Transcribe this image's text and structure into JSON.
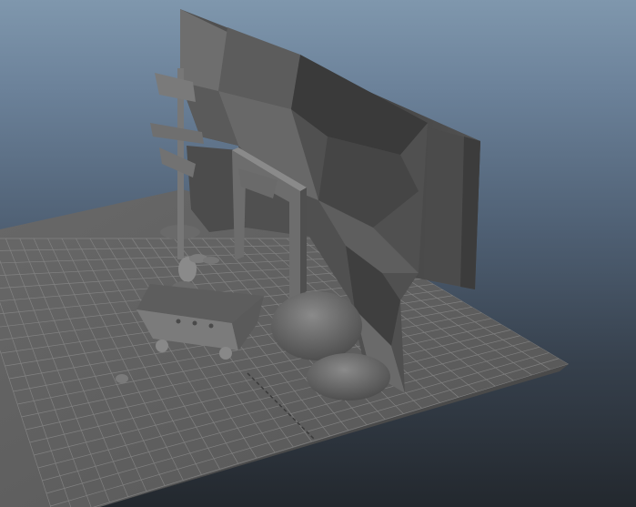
{
  "viewport": {
    "name": "3d-scene-viewport",
    "background_top": "#7f97ad",
    "background_bottom": "#23282e",
    "grid_color": "#9a9a9a",
    "model_color": "#5a5a5a"
  },
  "scene_objects": [
    "ground-grid",
    "rock-wall",
    "back-panel",
    "door-frame",
    "signpost",
    "mine-cart",
    "cart-character",
    "boulder-large",
    "boulder-small",
    "pebble"
  ]
}
